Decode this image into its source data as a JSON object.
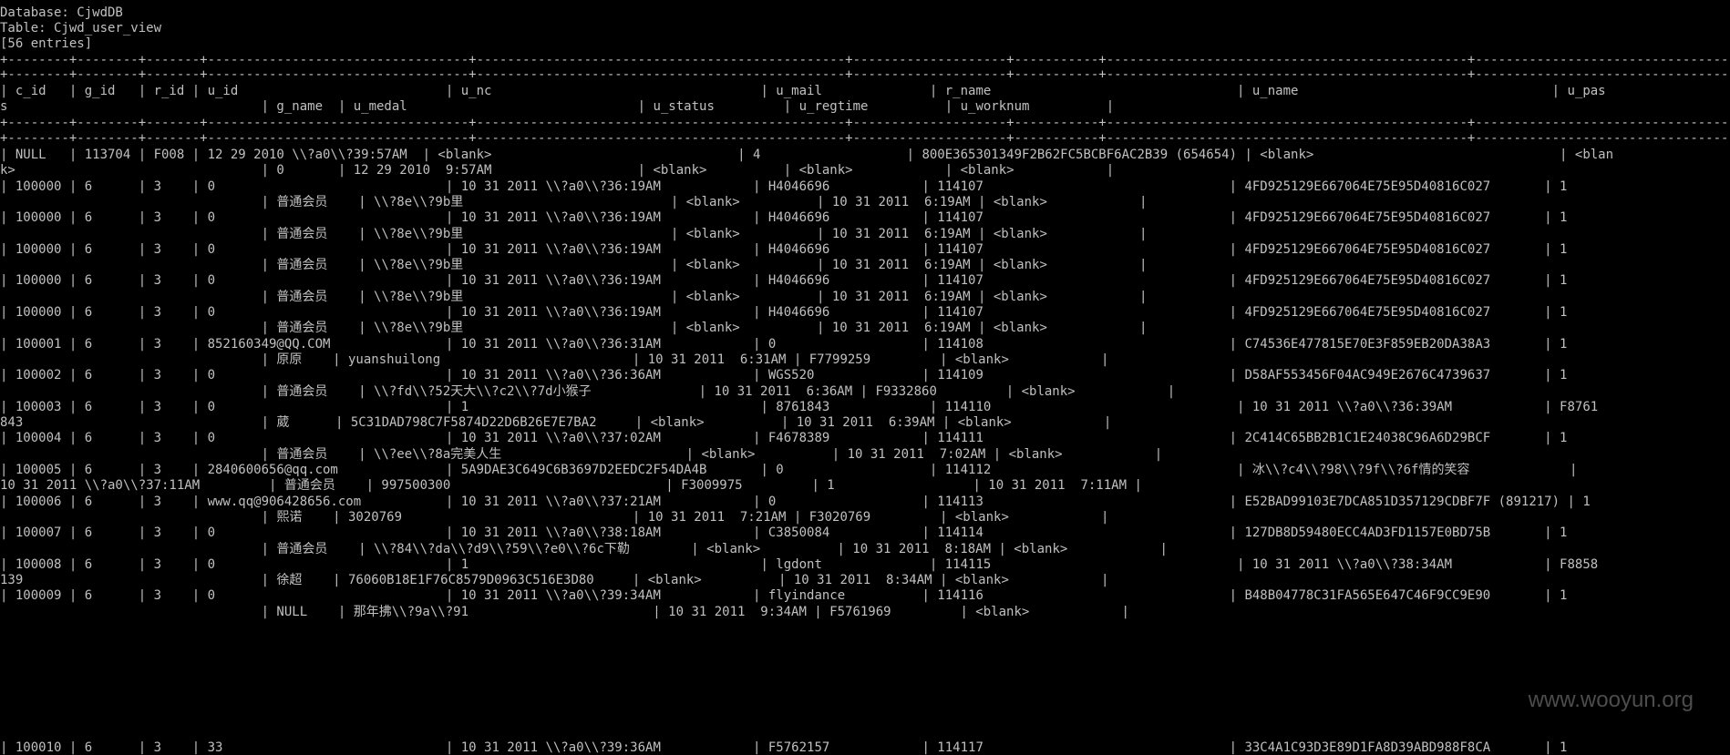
{
  "header": {
    "database": "Database: CjwdDB",
    "table": "Table: Cjwd_user_view",
    "entries": "[56 entries]"
  },
  "separator": "+--------+--------+-------+----------------------------------+------------------------------------------------+--------------------+-----------+-----------------------------------------------+---------------------------------------------+",
  "separator_b": "+--------+--------+-------+----------------------------------+------------------------------------------------+--------------------+-----------+-----------------------------------------------+-----------------------------------------------------------------------+",
  "column_header": [
    "| c_id   | g_id   | r_id | u_id                           | u_nc                                   | u_mail              | r_name                                | u_name                                 | u_pas",
    "s                                 | g_name  | u_medal                              | u_status         | u_regtime          | u_worknum          |"
  ],
  "rows": [
    [
      "| NULL   | 113704 | F008 | 12 29 2010 \\\\?a0\\\\?39:57AM  | <blank>                                | 4                   | 800E365301349F2B62FC5BCBF6AC2B39 (654654) | <blank>                                | <blan",
      "k>                                | 0       | 12 29 2010  9:57AM                   | <blank>          | <blank>            | <blank>            |"
    ],
    [
      "| 100000 | 6      | 3    | 0                              | 10 31 2011 \\\\?a0\\\\?36:19AM            | H4046696            | 114107                                | 4FD925129E667064E75E95D40816C027       | 1",
      "                                  | 普通会员    | \\\\?8e\\\\?9b里                           | <blank>          | 10 31 2011  6:19AM | <blank>            |"
    ],
    [
      "| 100000 | 6      | 3    | 0                              | 10 31 2011 \\\\?a0\\\\?36:19AM            | H4046696            | 114107                                | 4FD925129E667064E75E95D40816C027       | 1",
      "                                  | 普通会员    | \\\\?8e\\\\?9b里                           | <blank>          | 10 31 2011  6:19AM | <blank>            |"
    ],
    [
      "| 100000 | 6      | 3    | 0                              | 10 31 2011 \\\\?a0\\\\?36:19AM            | H4046696            | 114107                                | 4FD925129E667064E75E95D40816C027       | 1",
      "                                  | 普通会员    | \\\\?8e\\\\?9b里                           | <blank>          | 10 31 2011  6:19AM | <blank>            |"
    ],
    [
      "| 100000 | 6      | 3    | 0                              | 10 31 2011 \\\\?a0\\\\?36:19AM            | H4046696            | 114107                                | 4FD925129E667064E75E95D40816C027       | 1",
      "                                  | 普通会员    | \\\\?8e\\\\?9b里                           | <blank>          | 10 31 2011  6:19AM | <blank>            |"
    ],
    [
      "| 100000 | 6      | 3    | 0                              | 10 31 2011 \\\\?a0\\\\?36:19AM            | H4046696            | 114107                                | 4FD925129E667064E75E95D40816C027       | 1",
      "                                  | 普通会员    | \\\\?8e\\\\?9b里                           | <blank>          | 10 31 2011  6:19AM | <blank>            |"
    ],
    [
      "| 100001 | 6      | 3    | 852160349@QQ.COM               | 10 31 2011 \\\\?a0\\\\?36:31AM            | 0                   | 114108                                | C74536E477815E70E3F859EB20DA38A3       | 1",
      "                                  | 原原    | yuanshuilong                         | 10 31 2011  6:31AM | F7799259         | <blank>            |"
    ],
    [
      "| 100002 | 6      | 3    | 0                              | 10 31 2011 \\\\?a0\\\\?36:36AM            | WGS520              | 114109                                | D58AF553456F04AC949E2676C4739637       | 1",
      "                                  | 普通会员    | \\\\?fd\\\\?52天大\\\\?c2\\\\?7d小猴子              | 10 31 2011  6:36AM | F9332860         | <blank>            |"
    ],
    [
      "| 100003 | 6      | 3    | 0                              | 1                                      | 8761843             | 114110                                | 10 31 2011 \\\\?a0\\\\?36:39AM            | F8761",
      "843                               | 葳      | 5C31DAD798C7F5874D22D6B26E7E7BA2     | <blank>          | 10 31 2011  6:39AM | <blank>            |"
    ],
    [
      "| 100004 | 6      | 3    | 0                              | 10 31 2011 \\\\?a0\\\\?37:02AM            | F4678389            | 114111                                | 2C414C65BB2B1C1E24038C96A6D29BCF       | 1",
      "                                  | 普通会员    | \\\\?ee\\\\?8a完美人生                        | <blank>          | 10 31 2011  7:02AM | <blank>            |"
    ],
    [
      "| 100005 | 6      | 3    | 2840600656@qq.com              | 5A9DAE3C649C6B3697D2EEDC2F54DA4B       | 0                   | 114112                                | 冰\\\\?c4\\\\?98\\\\?9f\\\\?6f情的笑容             |",
      "10 31 2011 \\\\?a0\\\\?37:11AM         | 普通会员    | 997500300                            | F3009975         | 1                  | 10 31 2011  7:11AM |"
    ],
    [
      "| 100006 | 6      | 3    | www.qq@906428656.com           | 10 31 2011 \\\\?a0\\\\?37:21AM            | 0                   | 114113                                | E52BAD99103E7DCA851D357129CDBF7F (891217) | 1",
      "                                  | 熙诺    | 3020769                              | 10 31 2011  7:21AM | F3020769         | <blank>            |"
    ],
    [
      "| 100007 | 6      | 3    | 0                              | 10 31 2011 \\\\?a0\\\\?38:18AM            | C3850084            | 114114                                | 127DB8D59480ECC4AD3FD1157E0BD75B       | 1",
      "                                  | 普通会员    | \\\\?84\\\\?da\\\\?d9\\\\?59\\\\?e0\\\\?6c下勒        | <blank>          | 10 31 2011  8:18AM | <blank>            |"
    ],
    [
      "| 100008 | 6      | 3    | 0                              | 1                                      | lgdont              | 114115                                | 10 31 2011 \\\\?a0\\\\?38:34AM            | F8858",
      "139                               | 徐超    | 76060B18E1F76C8579D0963C516E3D80     | <blank>          | 10 31 2011  8:34AM | <blank>            |"
    ],
    [
      "| 100009 | 6      | 3    | 0                              | 10 31 2011 \\\\?a0\\\\?39:34AM            | flyindance          | 114116                                | B48B04778C31FA565E647C46F9CC9E90       | 1",
      "                                  | NULL    | 那年拂\\\\?9a\\\\?91                        | 10 31 2011  9:34AM | F5761969         | <blank>            |"
    ]
  ],
  "partial_row": "| 100010 | 6      | 3    | 33                             | 10 31 2011 \\\\?a0\\\\?39:36AM            | F5762157            | 114117                                | 33C4A1C93D3E89D1FA8D39ABD988F8CA       | 1",
  "watermark": "www.wooyun.org"
}
